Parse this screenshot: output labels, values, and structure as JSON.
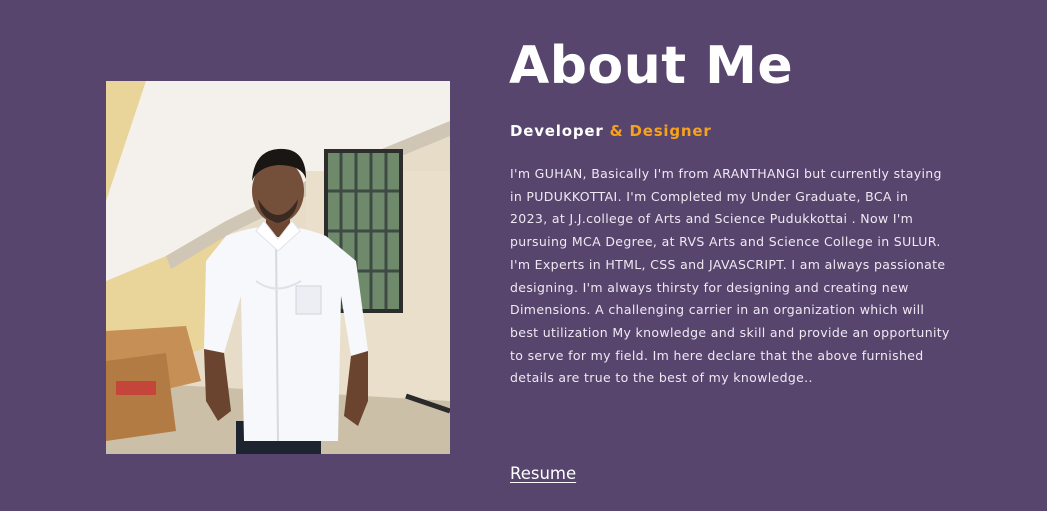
{
  "about": {
    "title": "About Me",
    "subtitle_main": "Developer",
    "subtitle_accent": "& Designer",
    "bio": "I'm GUHAN, Basically I'm from ARANTHANGI but currently staying in PUDUKKOTTAI. I'm Completed my Under Graduate, BCA in 2023, at J.J.college of Arts and Science Pudukkottai . Now I'm pursuing MCA Degree, at RVS Arts and Science College in SULUR. I'm Experts in HTML, CSS and JAVASCRIPT. I am always passionate designing. I'm always thirsty for designing and creating new Dimensions. A challenging carrier in an organization which will best utilization My knowledge and skill and provide an opportunity to serve for my field. Im here declare that the above furnished details are true to the best of my knowledge..",
    "resume_label": "Resume"
  },
  "colors": {
    "background": "#57456d",
    "accent": "#f7a21c",
    "text": "#ffffff"
  }
}
